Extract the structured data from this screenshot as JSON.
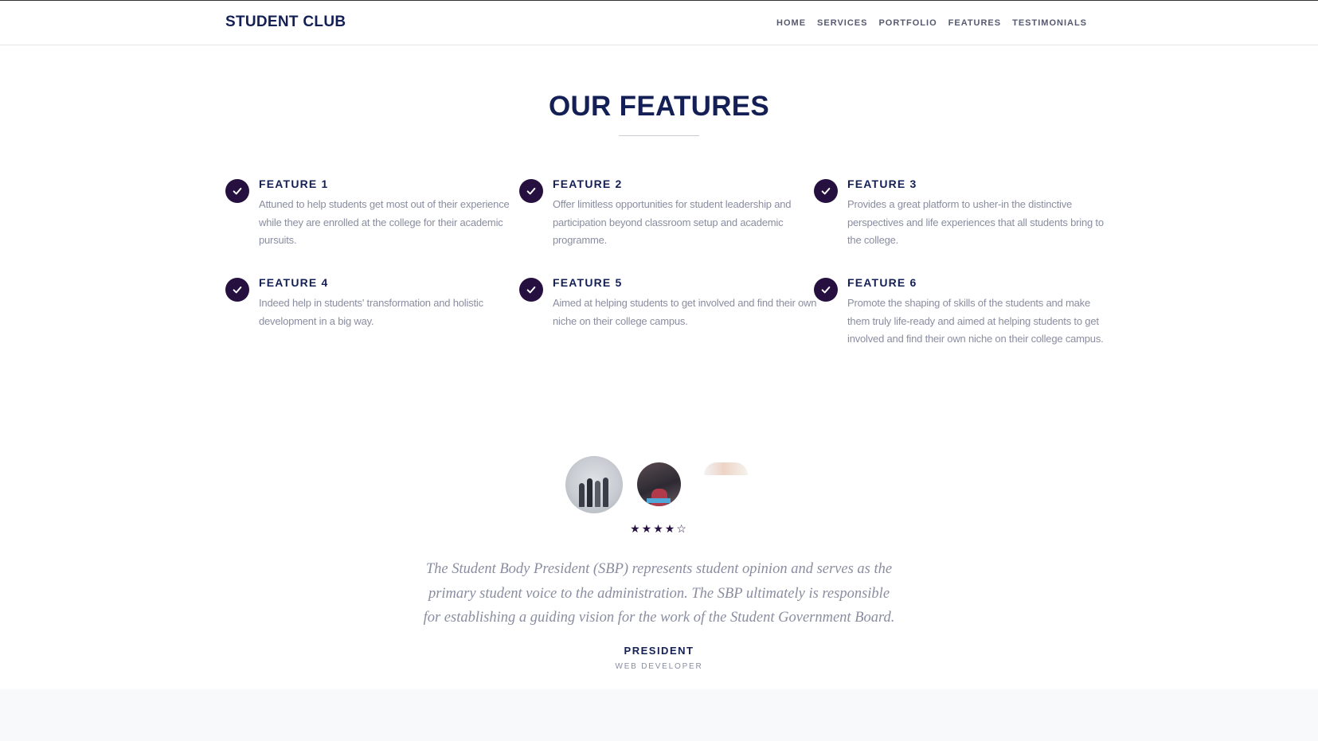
{
  "header": {
    "brand": "STUDENT CLUB",
    "nav": [
      "HOME",
      "SERVICES",
      "PORTFOLIO",
      "FEATURES",
      "TESTIMONIALS"
    ]
  },
  "features_section": {
    "title": "OUR FEATURES",
    "items": [
      {
        "title": "FEATURE 1",
        "text": "Attuned to help students get most out of their experience while they are enrolled at the college for their academic pursuits."
      },
      {
        "title": "FEATURE 2",
        "text": "Offer limitless opportunities for student leadership and participation beyond classroom setup and academic programme."
      },
      {
        "title": "FEATURE 3",
        "text": "Provides a great platform to usher-in the distinctive perspectives and life experiences that all students bring to the college."
      },
      {
        "title": "FEATURE 4",
        "text": "Indeed help in students' transformation and holistic development in a big way."
      },
      {
        "title": "FEATURE 5",
        "text": "Aimed at helping students to get involved and find their own niche on their college campus."
      },
      {
        "title": "FEATURE 6",
        "text": "Promote the shaping of skills of the students and make them truly life-ready and aimed at helping students to get involved and find their own niche on their college campus."
      }
    ]
  },
  "testimonial": {
    "rating": 4,
    "rating_max": 5,
    "stars_text": "★★★★☆",
    "quote": "The Student Body President (SBP) represents student opinion and serves as the primary student voice to the administration. The SBP ultimately is responsible for establishing a guiding vision for the work of the Student Government Board.",
    "author": "PRESIDENT",
    "role": "WEB DEVELOPER"
  },
  "colors": {
    "primary": "#142055",
    "accent": "#26103f",
    "text_muted": "#8a8da0"
  },
  "icons": {
    "feature_icon": "check-circle-icon",
    "rating_icon": "star-icon"
  }
}
